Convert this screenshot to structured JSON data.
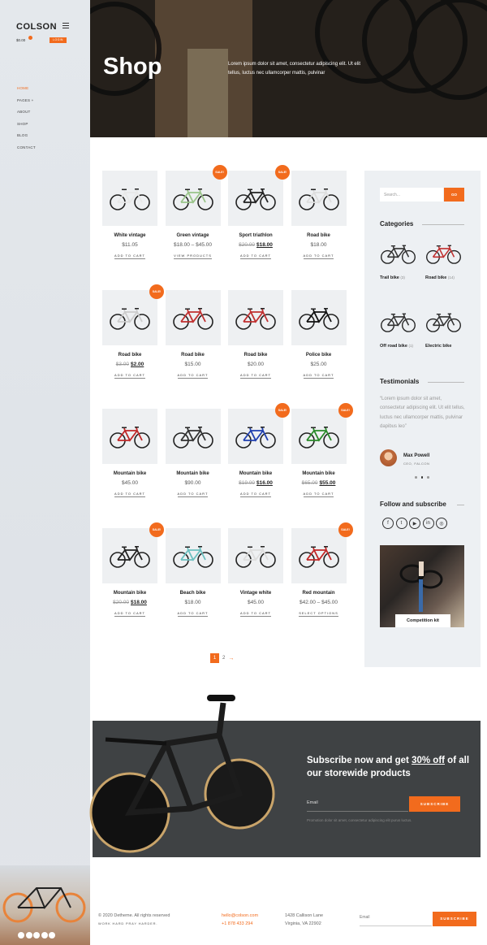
{
  "brand": {
    "logo": "COLSON",
    "cart_total": "$0.00",
    "login": "LOGIN"
  },
  "nav": [
    {
      "label": "HOME",
      "active": true
    },
    {
      "label": "PAGES +"
    },
    {
      "label": "ABOUT"
    },
    {
      "label": "SHOP"
    },
    {
      "label": "BLOG"
    },
    {
      "label": "CONTACT"
    }
  ],
  "hero": {
    "title": "Shop",
    "text": "Lorem ipsum dolor sit amet, consectetur adipiscing elit. Ut elit tellus, luctus nec ullamcorper mattis, pulvinar"
  },
  "products": [
    {
      "name": "White vintage",
      "price": "$11.05",
      "button": "ADD TO CART",
      "sale": false,
      "color": "#e8e8e8"
    },
    {
      "name": "Green vintage",
      "price": "$18.00 – $45.00",
      "button": "VIEW PRODUCTS",
      "sale": true,
      "color": "#9ac48a"
    },
    {
      "name": "Sport triathlon",
      "old": "$20.00",
      "new": "$18.00",
      "button": "ADD TO CART",
      "sale": true,
      "color": "#222"
    },
    {
      "name": "Road bike",
      "price": "$18.00",
      "button": "ADD TO CART",
      "sale": false,
      "color": "#ddd"
    },
    {
      "name": "Road bike",
      "old": "$3.00",
      "new": "$2.00",
      "button": "ADD TO CART",
      "sale": true,
      "color": "#ccc"
    },
    {
      "name": "Road bike",
      "price": "$15.00",
      "button": "ADD TO CART",
      "sale": false,
      "color": "#c03030"
    },
    {
      "name": "Road bike",
      "price": "$20.00",
      "button": "ADD TO CART",
      "sale": false,
      "color": "#c03030"
    },
    {
      "name": "Police bike",
      "price": "$25.00",
      "button": "ADD TO CART",
      "sale": false,
      "color": "#111"
    },
    {
      "name": "Mountain bike",
      "price": "$45.00",
      "button": "ADD TO CART",
      "sale": false,
      "color": "#c02828"
    },
    {
      "name": "Mountain bike",
      "price": "$90.00",
      "button": "ADD TO CART",
      "sale": false,
      "color": "#333"
    },
    {
      "name": "Mountain bike",
      "old": "$19.00",
      "new": "$16.00",
      "button": "ADD TO CART",
      "sale": true,
      "color": "#2040b0"
    },
    {
      "name": "Mountain bike",
      "old": "$65.00",
      "new": "$55.00",
      "button": "ADD TO CART",
      "sale": true,
      "color": "#2a8a2a"
    },
    {
      "name": "Mountain bike",
      "old": "$20.00",
      "new": "$18.00",
      "button": "ADD TO CART",
      "sale": true,
      "color": "#222"
    },
    {
      "name": "Beach bike",
      "price": "$18.00",
      "button": "ADD TO CART",
      "sale": false,
      "color": "#6cc0c0"
    },
    {
      "name": "Vintage white",
      "price": "$45.00",
      "button": "ADD TO CART",
      "sale": false,
      "color": "#ddd"
    },
    {
      "name": "Red mountain",
      "price": "$42.00 – $45.00",
      "button": "SELECT OPTIONS",
      "sale": true,
      "color": "#c02828"
    }
  ],
  "sale_label": "SALE!",
  "pagination": {
    "current": "1",
    "next": "2",
    "arrow": "→"
  },
  "widget": {
    "search_placeholder": "Search...",
    "search_button": "GO",
    "categories_title": "Categories",
    "categories": [
      {
        "name": "Trail bike",
        "count": "(3)"
      },
      {
        "name": "Road bike",
        "count": "(14)"
      },
      {
        "name": "Off road bike",
        "count": "(1)"
      },
      {
        "name": "Electric bike",
        "count": ""
      }
    ],
    "testimonials_title": "Testimonials",
    "quote": "“Lorem ipsum dolor sit amet, consectetur adipiscing elit. Ut elit tellus, luctus nec ullamcorper mattis, pulvinar dapibus leo”",
    "author": "Max Powell",
    "role": "CEO, FALCON",
    "follow_title": "Follow and subscribe",
    "social": [
      "f",
      "t",
      "▶",
      "in",
      "◎"
    ],
    "promo": "Competition kit"
  },
  "subscribe": {
    "title_a": "Subscribe now and get ",
    "title_u": "30% off",
    "title_b": " of all our storewide products",
    "email": "Email",
    "button": "SUBSCRIBE",
    "note": "Promotion dolor sit amet, consectetur adipiscing elit purus luctus."
  },
  "footer": {
    "copyright": "© 2020 Detheme. All rights reserved",
    "tagline": "WORK HARD PRAY HARDER.",
    "email": "hello@colson.com",
    "phone": "+1 878 433 294",
    "address1": "1428 Callison Lane",
    "address2": "Virginia, VA 22902",
    "email_placeholder": "Email",
    "button": "SUBSCRIBE"
  },
  "colors": {
    "accent": "#f26b1d",
    "dark": "#3f4244"
  }
}
